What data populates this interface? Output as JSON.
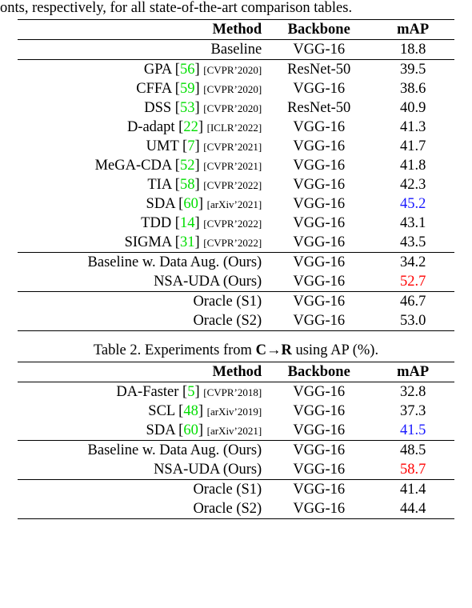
{
  "top_line": "onts, respectively, for all state-of-the-art comparison tables.",
  "headers": {
    "method": "Method",
    "backbone": "Backbone",
    "map": "mAP"
  },
  "t1": {
    "baseline": {
      "name": "Baseline",
      "backbone": "VGG-16",
      "map": "18.8"
    },
    "rows": [
      {
        "name": "GPA",
        "cite": "56",
        "venue": "[CVPR’2020]",
        "backbone": "ResNet-50",
        "map": "39.5"
      },
      {
        "name": "CFFA",
        "cite": "59",
        "venue": "[CVPR’2020]",
        "backbone": "VGG-16",
        "map": "38.6"
      },
      {
        "name": "DSS",
        "cite": "53",
        "venue": "[CVPR’2020]",
        "backbone": "ResNet-50",
        "map": "40.9"
      },
      {
        "name": "D-adapt",
        "cite": "22",
        "venue": "[ICLR’2022]",
        "backbone": "VGG-16",
        "map": "41.3"
      },
      {
        "name": "UMT",
        "cite": "7",
        "venue": "[CVPR’2021]",
        "backbone": "VGG-16",
        "map": "41.7"
      },
      {
        "name": "MeGA-CDA",
        "cite": "52",
        "venue": "[CVPR’2021]",
        "backbone": "VGG-16",
        "map": "41.8"
      },
      {
        "name": "TIA",
        "cite": "58",
        "venue": "[CVPR’2022]",
        "backbone": "VGG-16",
        "map": "42.3"
      },
      {
        "name": "SDA",
        "cite": "60",
        "venue": "[arXiv’2021]",
        "backbone": "VGG-16",
        "map": "45.2",
        "hl": "blue"
      },
      {
        "name": "TDD",
        "cite": "14",
        "venue": "[CVPR’2022]",
        "backbone": "VGG-16",
        "map": "43.1"
      },
      {
        "name": "SIGMA",
        "cite": "31",
        "venue": "[CVPR’2022]",
        "backbone": "VGG-16",
        "map": "43.5"
      }
    ],
    "ours": [
      {
        "name": "Baseline w. Data Aug. (Ours)",
        "backbone": "VGG-16",
        "map": "34.2"
      },
      {
        "name": "NSA-UDA (Ours)",
        "backbone": "VGG-16",
        "map": "52.7",
        "hl": "red"
      }
    ],
    "oracle": [
      {
        "name": "Oracle (S1)",
        "backbone": "VGG-16",
        "map": "46.7"
      },
      {
        "name": "Oracle (S2)",
        "backbone": "VGG-16",
        "map": "53.0"
      }
    ]
  },
  "t2": {
    "caption_pre": "Table 2. Experiments from ",
    "caption_c": "C",
    "caption_arrow": "→",
    "caption_r": "R",
    "caption_post": " using AP (%).",
    "rows": [
      {
        "name": "DA-Faster",
        "cite": "5",
        "venue": "[CVPR’2018]",
        "backbone": "VGG-16",
        "map": "32.8"
      },
      {
        "name": "SCL",
        "cite": "48",
        "venue": "[arXiv’2019]",
        "backbone": "VGG-16",
        "map": "37.3"
      },
      {
        "name": "SDA",
        "cite": "60",
        "venue": "[arXiv’2021]",
        "backbone": "VGG-16",
        "map": "41.5",
        "hl": "blue"
      }
    ],
    "ours": [
      {
        "name": "Baseline w. Data Aug. (Ours)",
        "backbone": "VGG-16",
        "map": "48.5"
      },
      {
        "name": "NSA-UDA (Ours)",
        "backbone": "VGG-16",
        "map": "58.7",
        "hl": "red"
      }
    ],
    "oracle": [
      {
        "name": "Oracle (S1)",
        "backbone": "VGG-16",
        "map": "41.4"
      },
      {
        "name": "Oracle (S2)",
        "backbone": "VGG-16",
        "map": "44.4"
      }
    ]
  },
  "chart_data": [
    {
      "type": "table",
      "title": "Table 1 (top)",
      "columns": [
        "Method",
        "Backbone",
        "mAP"
      ],
      "rows": [
        [
          "Baseline",
          "VGG-16",
          18.8
        ],
        [
          "GPA [56] CVPR'2020",
          "ResNet-50",
          39.5
        ],
        [
          "CFFA [59] CVPR'2020",
          "VGG-16",
          38.6
        ],
        [
          "DSS [53] CVPR'2020",
          "ResNet-50",
          40.9
        ],
        [
          "D-adapt [22] ICLR'2022",
          "VGG-16",
          41.3
        ],
        [
          "UMT [7] CVPR'2021",
          "VGG-16",
          41.7
        ],
        [
          "MeGA-CDA [52] CVPR'2021",
          "VGG-16",
          41.8
        ],
        [
          "TIA [58] CVPR'2022",
          "VGG-16",
          42.3
        ],
        [
          "SDA [60] arXiv'2021",
          "VGG-16",
          45.2
        ],
        [
          "TDD [14] CVPR'2022",
          "VGG-16",
          43.1
        ],
        [
          "SIGMA [31] CVPR'2022",
          "VGG-16",
          43.5
        ],
        [
          "Baseline w. Data Aug. (Ours)",
          "VGG-16",
          34.2
        ],
        [
          "NSA-UDA (Ours)",
          "VGG-16",
          52.7
        ],
        [
          "Oracle (S1)",
          "VGG-16",
          46.7
        ],
        [
          "Oracle (S2)",
          "VGG-16",
          53.0
        ]
      ]
    },
    {
      "type": "table",
      "title": "Table 2. Experiments from C→R using AP (%)",
      "columns": [
        "Method",
        "Backbone",
        "mAP"
      ],
      "rows": [
        [
          "DA-Faster [5] CVPR'2018",
          "VGG-16",
          32.8
        ],
        [
          "SCL [48] arXiv'2019",
          "VGG-16",
          37.3
        ],
        [
          "SDA [60] arXiv'2021",
          "VGG-16",
          41.5
        ],
        [
          "Baseline w. Data Aug. (Ours)",
          "VGG-16",
          48.5
        ],
        [
          "NSA-UDA (Ours)",
          "VGG-16",
          58.7
        ],
        [
          "Oracle (S1)",
          "VGG-16",
          41.4
        ],
        [
          "Oracle (S2)",
          "VGG-16",
          44.4
        ]
      ]
    }
  ]
}
